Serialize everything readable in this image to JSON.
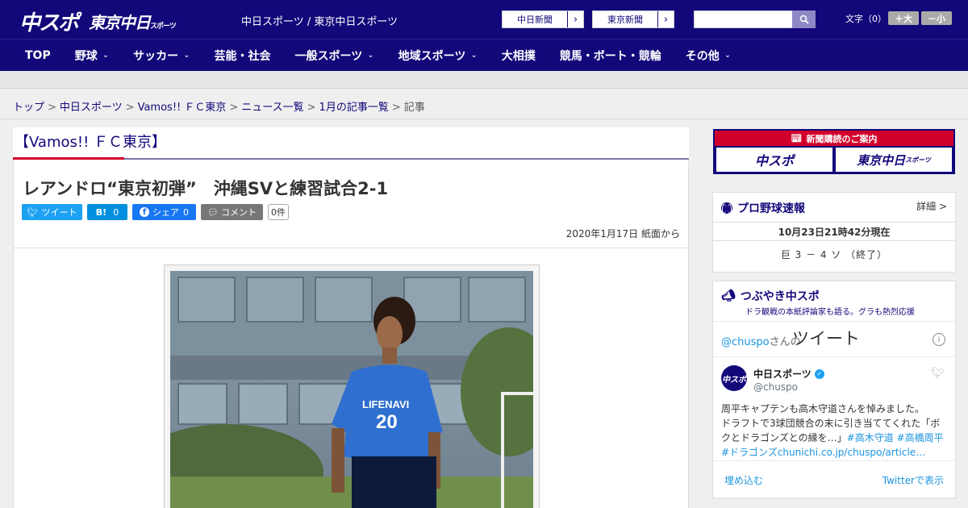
{
  "header": {
    "logo_main": "中スポ",
    "logo_tokyo": "東京中日",
    "logo_tokyo_sub": "スポーツ",
    "site_names": "中日スポーツ / 東京中日スポーツ",
    "paper_links": [
      {
        "label": "中日新聞"
      },
      {
        "label": "東京新聞"
      }
    ],
    "search": {
      "value": "",
      "icon": "search-icon"
    },
    "font_size": {
      "label": "文字（0）",
      "larger": "＋大",
      "smaller": "－小"
    }
  },
  "nav": {
    "items": [
      {
        "label": "TOP",
        "has_menu": false
      },
      {
        "label": "野球",
        "has_menu": true
      },
      {
        "label": "サッカー",
        "has_menu": true
      },
      {
        "label": "芸能・社会",
        "has_menu": false
      },
      {
        "label": "一般スポーツ",
        "has_menu": true
      },
      {
        "label": "地域スポーツ",
        "has_menu": true
      },
      {
        "label": "大相撲",
        "has_menu": false
      },
      {
        "label": "競馬・ボート・競輪",
        "has_menu": false
      },
      {
        "label": "その他",
        "has_menu": true
      }
    ],
    "chevron": "⌄"
  },
  "breadcrumb": {
    "items": [
      "トップ",
      "中日スポーツ",
      "Vamos!! ＦＣ東京",
      "ニュース一覧",
      "1月の記事一覧"
    ],
    "current": "記事",
    "separator": ">"
  },
  "article": {
    "section": "【Vamos!! ＦＣ東京】",
    "headline": "レアンドロ“東京初弾”　沖縄SVと練習試合2-1",
    "share": {
      "twitter": "ツイート",
      "hatena": "B!",
      "hatena_count": "0",
      "facebook": "シェア",
      "facebook_count": "0",
      "comment": "コメント",
      "comment_count": "0件"
    },
    "date": "2020年1月17日 紙面から",
    "photo_jersey_number": "20",
    "photo_sponsor": "LIFENAVI"
  },
  "sidebar": {
    "ad": {
      "title": "新聞購読のご案内",
      "left": "中スポ",
      "right": "東京中日",
      "right_sub": "スポーツ"
    },
    "baseball": {
      "title": "プロ野球速報",
      "detail": "詳細 >",
      "time": "10月23日21時42分現在",
      "score": "巨 3 － 4 ソ （終了）"
    },
    "tweets": {
      "title": "つぶやき中スポ",
      "subtitle": "ドラ観戦の本紙評論家も語る。グラも熱烈応援",
      "header_handle": "@chuspo",
      "header_suffix": "さんの",
      "header_big": "ツイート",
      "account_name": "中日スポーツ",
      "account_handle": "@chuspo",
      "avatar_text": "中スポ",
      "text_1": "周平キャプテンも高木守道さんを悼みました。",
      "text_2": "ドラフトで3球団競合の末に引き当ててくれた「ボクとドラゴンズとの縁を…」",
      "tag_1": "#高木守道",
      "tag_2": "#高橋周平",
      "tag_3": "#ドラゴンズ",
      "link": "chunichi.co.jp/chuspo/article…",
      "embed": "埋め込む",
      "view_on": "Twitterで表示"
    }
  }
}
